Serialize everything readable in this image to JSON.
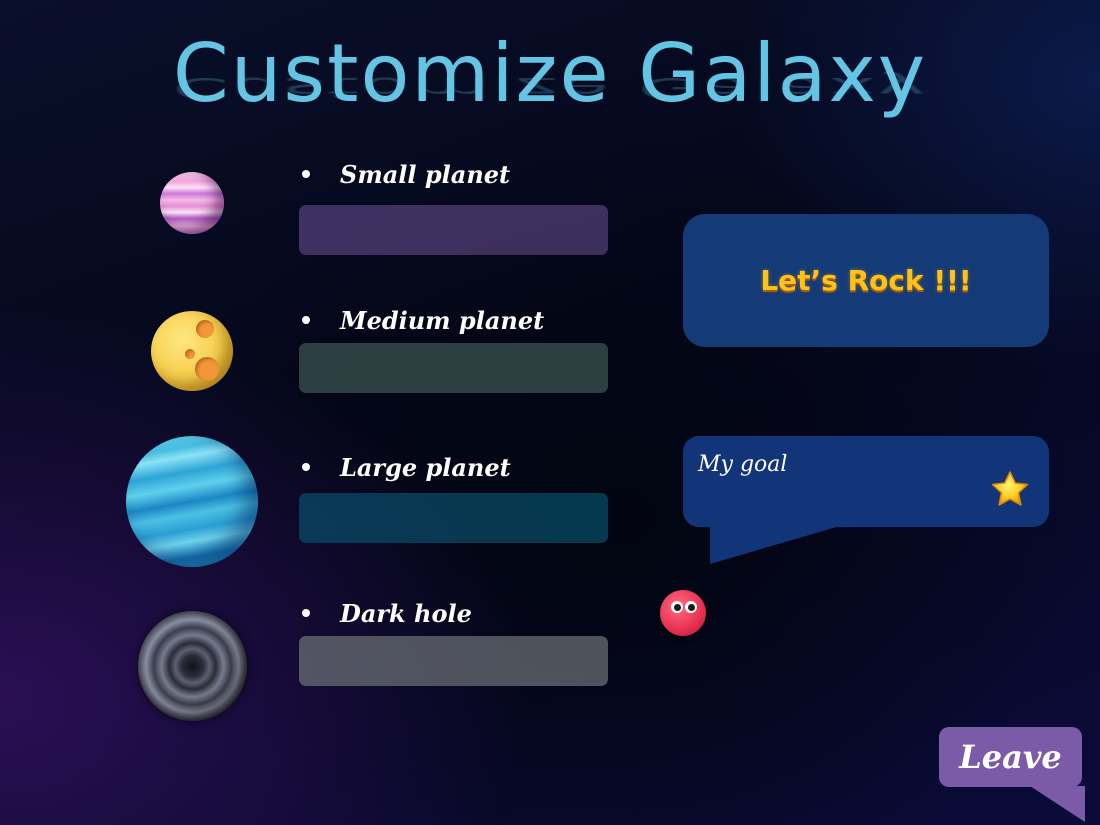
{
  "title": "Customize Galaxy",
  "items": [
    {
      "label": "Small planet",
      "icon": "small-planet-icon",
      "value": ""
    },
    {
      "label": "Medium planet",
      "icon": "medium-planet-icon",
      "value": ""
    },
    {
      "label": "Large planet",
      "icon": "large-planet-icon",
      "value": ""
    },
    {
      "label": "Dark hole",
      "icon": "dark-hole-icon",
      "value": ""
    }
  ],
  "rock_button": {
    "label": "Let’s Rock !!!"
  },
  "goal": {
    "label": "My goal",
    "icon": "star-icon"
  },
  "leave_button": {
    "label": "Leave"
  },
  "colors": {
    "title": "#63c4e4",
    "rock_text": "#ffc21a",
    "rock_box": "#143a78",
    "goal_box": "#12357a",
    "leave_button": "#7b5ba8"
  }
}
